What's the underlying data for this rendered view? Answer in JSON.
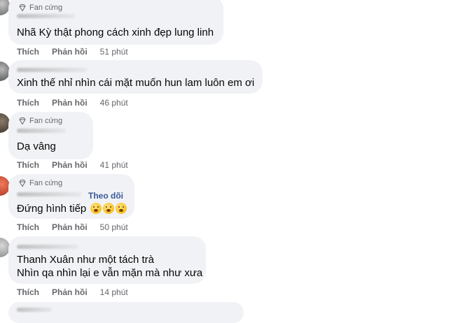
{
  "comments": [
    {
      "badge": "Fan cứng",
      "text_lines": [
        "Nhã Kỳ thật phong cách xinh đẹp lung linh"
      ],
      "like": "Thích",
      "reply": "Phản hồi",
      "time": "51 phút"
    },
    {
      "badge": "",
      "text_lines": [
        "Xinh thế nhỉ nhìn cái mặt muốn hun lam luôn em ơi"
      ],
      "like": "Thích",
      "reply": "Phản hồi",
      "time": "46 phút"
    },
    {
      "badge": "Fan cứng",
      "text_lines": [
        "Dạ vâng"
      ],
      "like": "Thích",
      "reply": "Phản hồi",
      "time": "41 phút"
    },
    {
      "badge": "Fan cứng",
      "follow": "Theo dõi",
      "text_lines": [
        "Đứng hình tiếp"
      ],
      "emoji_count": 3,
      "like": "Thích",
      "reply": "Phản hồi",
      "time": "50 phút"
    },
    {
      "badge": "",
      "text_lines": [
        "Thanh Xuân như một tách trà",
        "Nhìn qa nhìn lại e vẫn mặn mà như xưa"
      ],
      "like": "Thích",
      "reply": "Phản hồi",
      "time": "14 phút"
    }
  ],
  "icons": {
    "badge": "diamond-icon",
    "avatar": "avatar"
  },
  "colors": {
    "bubble": "#f0f2f5",
    "meta": "#65676b",
    "link": "#385898"
  }
}
